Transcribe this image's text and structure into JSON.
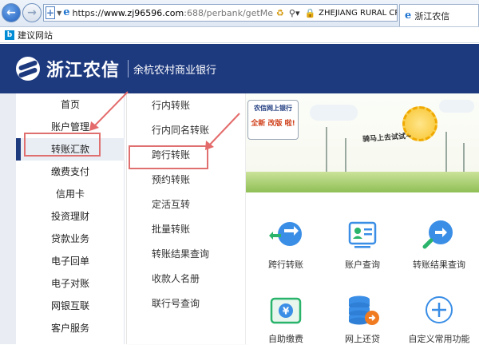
{
  "browser": {
    "url_https": "https://",
    "url_host": "www.zj96596.com",
    "url_rest": ":688/perbank/getMe",
    "site_identity": "ZHEJIANG RURAL CR...",
    "tab_title": "浙江农信",
    "favorites": [
      {
        "label": "建议网站"
      }
    ]
  },
  "header": {
    "brand": "浙江农信",
    "bank_name": "余杭农村商业银行"
  },
  "sidebar": {
    "items": [
      {
        "label": "首页"
      },
      {
        "label": "账户管理"
      },
      {
        "label": "转账汇款"
      },
      {
        "label": "缴费支付"
      },
      {
        "label": "信用卡"
      },
      {
        "label": "投资理财"
      },
      {
        "label": "贷款业务"
      },
      {
        "label": "电子回单"
      },
      {
        "label": "电子对账"
      },
      {
        "label": "网银互联"
      },
      {
        "label": "客户服务"
      }
    ],
    "active": "转账汇款"
  },
  "submenu": {
    "items": [
      {
        "label": "行内转账"
      },
      {
        "label": "行内同名转账"
      },
      {
        "label": "跨行转账"
      },
      {
        "label": "预约转账"
      },
      {
        "label": "定活互转"
      },
      {
        "label": "批量转账"
      },
      {
        "label": "转账结果查询"
      },
      {
        "label": "收款人名册"
      },
      {
        "label": "联行号查询"
      }
    ],
    "highlighted": "跨行转账"
  },
  "banner": {
    "sign_title": "农信网上银行",
    "sign_badge": "全新 改版 啦!",
    "slogan": "骑马上去试试~"
  },
  "quick_access": {
    "items": [
      {
        "label": "跨行转账",
        "icon": "transfer-arrows-icon"
      },
      {
        "label": "账户查询",
        "icon": "account-card-icon"
      },
      {
        "label": "转账结果查询",
        "icon": "search-arrow-icon"
      },
      {
        "label": "自助缴费",
        "icon": "payment-yen-icon"
      },
      {
        "label": "网上还贷",
        "icon": "coins-stack-icon"
      },
      {
        "label": "自定义常用功能",
        "icon": "add-circle-icon"
      }
    ]
  },
  "colors": {
    "brand_navy": "#1e3a7f",
    "highlight_red": "#e06f6f",
    "icon_blue": "#3a8ee6"
  }
}
